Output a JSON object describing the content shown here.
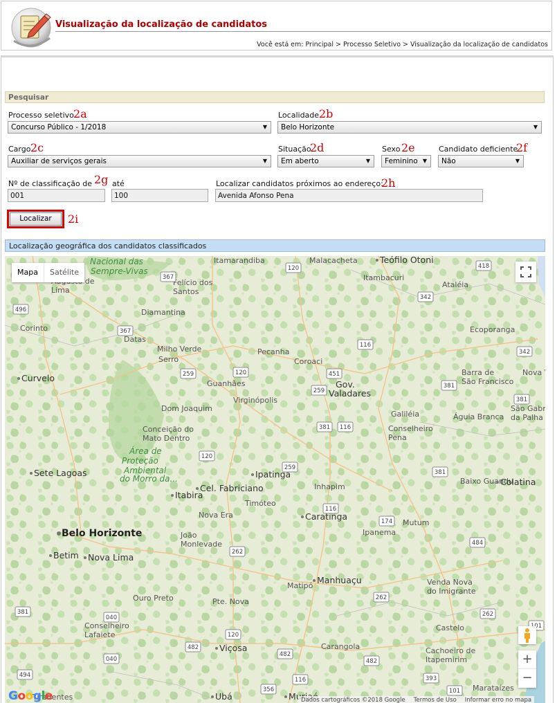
{
  "header": {
    "title": "Visualização da localização de candidatos",
    "breadcrumb": "Você está em: Principal > Processo Seletivo > Visualização da localização de candidatos"
  },
  "search": {
    "section_title": "Pesquisar",
    "processo_label": "Processo seletivo",
    "processo_value": "Concurso Público - 1/2018",
    "localidade_label": "Localidade",
    "localidade_value": "Belo Horizonte",
    "cargo_label": "Cargo",
    "cargo_value": "Auxiliar de serviços gerais",
    "situacao_label": "Situação",
    "situacao_value": "Em aberto",
    "sexo_label": "Sexo",
    "sexo_value": "Feminino",
    "deficiente_label": "Candidato deficiente",
    "deficiente_value": "Não",
    "classif_label": "Nº de classificação de",
    "classif_from": "001",
    "ate_label": "até",
    "classif_to": "100",
    "endereco_label": "Localizar candidatos próximos ao endereço:",
    "endereco_value": "Avenida Afonso Pena",
    "button_label": "Localizar"
  },
  "annotations": {
    "a2a": "2a",
    "a2b": "2b",
    "a2c": "2c",
    "a2d": "2d",
    "a2e": "2e",
    "a2f": "2f",
    "a2g": "2g",
    "a2h": "2h",
    "a2i": "2i"
  },
  "map": {
    "section_title": "Localização geográfica dos candidatos classificados",
    "type_map": "Mapa",
    "type_satellite": "Satélite",
    "zoom_in": "+",
    "zoom_out": "−",
    "logo": "Google",
    "attribution": "Dados cartográficos ©2018 Google",
    "terms": "Termos de Uso",
    "report": "Informar erro no mapa",
    "cities": [
      "Teófilo Otoni",
      "Itamarandiba",
      "Malacacheta",
      "Itambacuri",
      "Ataléia",
      "Nacional das",
      "Sempre-Vivas",
      "Augusto de Lima",
      "Felício dos Santos",
      "Diamantina",
      "Ecoporanga",
      "Corinto",
      "Datas",
      "Milho Verde",
      "Serro",
      "Pecanha",
      "Coroaci",
      "Barra de São Francisco",
      "Nova Ve",
      "Curvelo",
      "Guanhães",
      "Gov. Valadares",
      "Virginópolis",
      "Dom Joaquim",
      "Galiléia",
      "Águia Branca",
      "São Gabriel da Palha",
      "Conceição do Mato Dentro",
      "Conselheiro Pena",
      "Área de Proteção Ambiental do Morro da...",
      "Sete Lagoas",
      "Ipatinga",
      "Baixo Guandu",
      "Colatina",
      "Itabira",
      "Cel. Fabriciano",
      "Inhapim",
      "Timóteo",
      "Nova Era",
      "Caratinga",
      "Mutum",
      "Belo Horizonte",
      "João Monlevade",
      "Ipanema",
      "Betim",
      "Nova Lima",
      "Manhuaçu",
      "Matipó",
      "Venda Nova do Imigrante",
      "Ouro Preto",
      "Pte. Nova",
      "Conselheiro Lafaiete",
      "Castelo",
      "Viçosa",
      "Carangola",
      "Cachoeiro de Itapemirim",
      "Ubá",
      "Muriaé",
      "Tiradentes",
      "Marataízes"
    ],
    "roads": [
      "120",
      "418",
      "367",
      "342",
      "496",
      "367",
      "116",
      "342",
      "259",
      "120",
      "451",
      "259",
      "381",
      "381",
      "381",
      "116",
      "120",
      "259",
      "381",
      "116",
      "174",
      "484",
      "262",
      "262",
      "262",
      "381",
      "040",
      "101",
      "120",
      "482",
      "482",
      "040",
      "482",
      "393",
      "494",
      "116",
      "356",
      "101"
    ]
  }
}
